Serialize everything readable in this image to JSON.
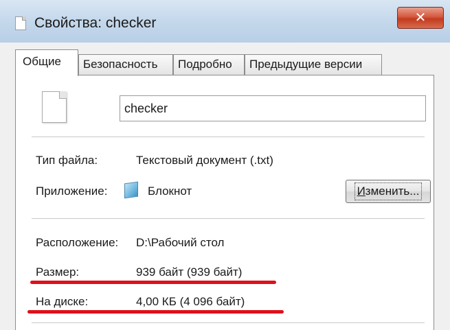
{
  "window": {
    "title": "Свойства: checker",
    "close_icon": "close-icon",
    "colors": {
      "titlebar": "#c6d9ec",
      "close_button": "#d5583f",
      "highlight": "#e0101a"
    }
  },
  "tabs": [
    {
      "label": "Общие",
      "active": true
    },
    {
      "label": "Безопасность",
      "active": false
    },
    {
      "label": "Подробно",
      "active": false
    },
    {
      "label": "Предыдущие версии",
      "active": false
    }
  ],
  "general": {
    "file_icon": "text-file-icon",
    "file_name": "checker",
    "file_type_label": "Тип файла:",
    "file_type_value": "Текстовый документ (.txt)",
    "app_label": "Приложение:",
    "app_icon": "notepad-icon",
    "app_value": "Блокнот",
    "change_button": "Изменить...",
    "location_label": "Расположение:",
    "location_value": "D:\\Рабочий стол",
    "size_label": "Размер:",
    "size_value": "939 байт (939 байт)",
    "disk_label": "На диске:",
    "disk_value": "4,00 КБ (4 096 байт)"
  }
}
